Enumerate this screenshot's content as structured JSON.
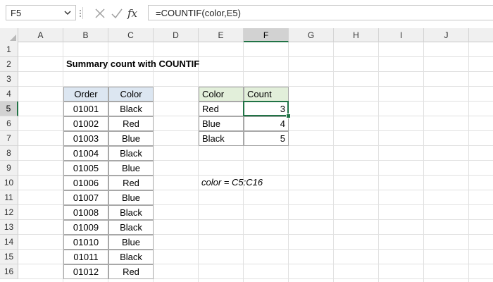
{
  "formula_bar": {
    "name_box": "F5",
    "formula": "=COUNTIF(color,E5)"
  },
  "columns": [
    "A",
    "B",
    "C",
    "D",
    "E",
    "F",
    "G",
    "H",
    "I",
    "J"
  ],
  "rows": [
    "1",
    "2",
    "3",
    "4",
    "5",
    "6",
    "7",
    "8",
    "9",
    "10",
    "11",
    "12",
    "13",
    "14",
    "15",
    "16"
  ],
  "selected": {
    "column": "F",
    "row": "5"
  },
  "sheet": {
    "title": "Summary count with COUNTIF",
    "orders_table": {
      "headers": [
        "Order",
        "Color"
      ],
      "rows": [
        [
          "01001",
          "Black"
        ],
        [
          "01002",
          "Red"
        ],
        [
          "01003",
          "Blue"
        ],
        [
          "01004",
          "Black"
        ],
        [
          "01005",
          "Blue"
        ],
        [
          "01006",
          "Red"
        ],
        [
          "01007",
          "Blue"
        ],
        [
          "01008",
          "Black"
        ],
        [
          "01009",
          "Black"
        ],
        [
          "01010",
          "Blue"
        ],
        [
          "01011",
          "Black"
        ],
        [
          "01012",
          "Red"
        ]
      ]
    },
    "summary_table": {
      "headers": [
        "Color",
        "Count"
      ],
      "rows": [
        [
          "Red",
          "3"
        ],
        [
          "Blue",
          "4"
        ],
        [
          "Black",
          "5"
        ]
      ]
    },
    "named_range_note": "color = C5:C16"
  },
  "colors": {
    "header_blue": "#dce6f1",
    "header_green": "#e2efda",
    "excel_green": "#217346"
  },
  "icons": [
    "dropdown-icon",
    "cancel-icon",
    "enter-icon",
    "function-icon"
  ]
}
